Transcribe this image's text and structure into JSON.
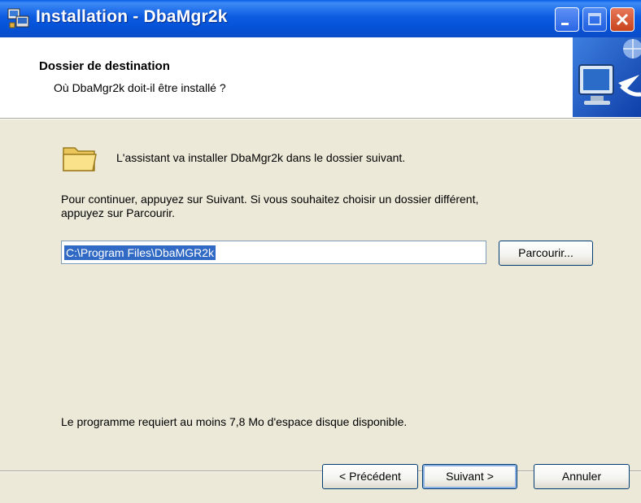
{
  "window": {
    "title": "Installation - DbaMgr2k",
    "controls": [
      "minimize",
      "maximize",
      "close"
    ]
  },
  "header": {
    "title": "Dossier de destination",
    "subtitle": "Où DbaMgr2k doit-il être installé ?",
    "icon": "setup-monitor-icon"
  },
  "body": {
    "intro": "L'assistant va installer DbaMgr2k dans le dossier suivant.",
    "instructions_line1": "Pour continuer, appuyez sur Suivant. Si vous souhaitez choisir un dossier différent,",
    "instructions_line2": "appuyez sur Parcourir.",
    "path_value": "C:\\Program Files\\DbaMGR2k",
    "browse_label": "Parcourir...",
    "space_note": "Le programme requiert au moins 7,8 Mo d'espace disque disponible."
  },
  "footer": {
    "back_label": "< Précédent",
    "next_label": "Suivant >",
    "cancel_label": "Annuler"
  },
  "colors": {
    "titlebar": "#0553D8",
    "dialog_bg": "#ECE9D8",
    "selection": "#316AC5",
    "close_button": "#C7441C"
  }
}
